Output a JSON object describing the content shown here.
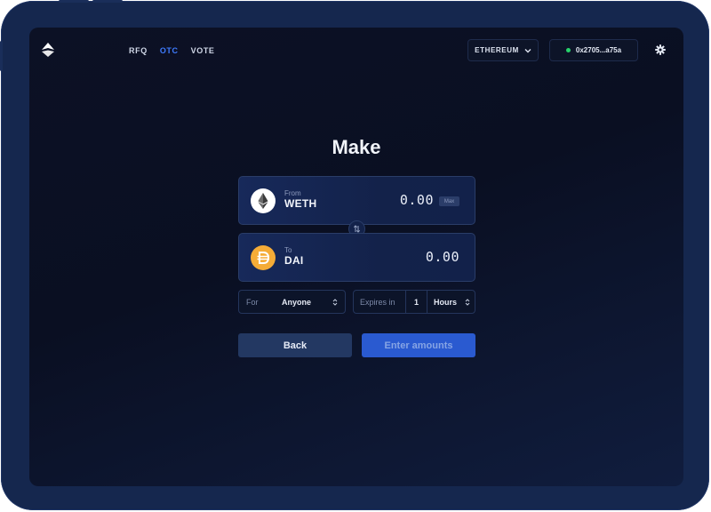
{
  "nav": {
    "items": [
      {
        "label": "RFQ",
        "active": false
      },
      {
        "label": "OTC",
        "active": true
      },
      {
        "label": "VOTE",
        "active": false
      }
    ]
  },
  "network": {
    "label": "ETHEREUM"
  },
  "wallet": {
    "address": "0x2705...a75a",
    "status_color": "#27d36b"
  },
  "title": "Make",
  "from": {
    "caption": "From",
    "token": "WETH",
    "amount": "0.00",
    "max_label": "Max",
    "icon": "ethereum-icon"
  },
  "to": {
    "caption": "To",
    "token": "DAI",
    "amount": "0.00",
    "icon": "dai-icon"
  },
  "for_field": {
    "label": "For",
    "value": "Anyone"
  },
  "expires": {
    "label": "Expires in",
    "value": "1",
    "unit": "Hours"
  },
  "buttons": {
    "back": "Back",
    "submit": "Enter amounts"
  },
  "colors": {
    "accent": "#3f7bff",
    "primary_button": "#2a5ad0",
    "dai": "#f5ac37"
  }
}
